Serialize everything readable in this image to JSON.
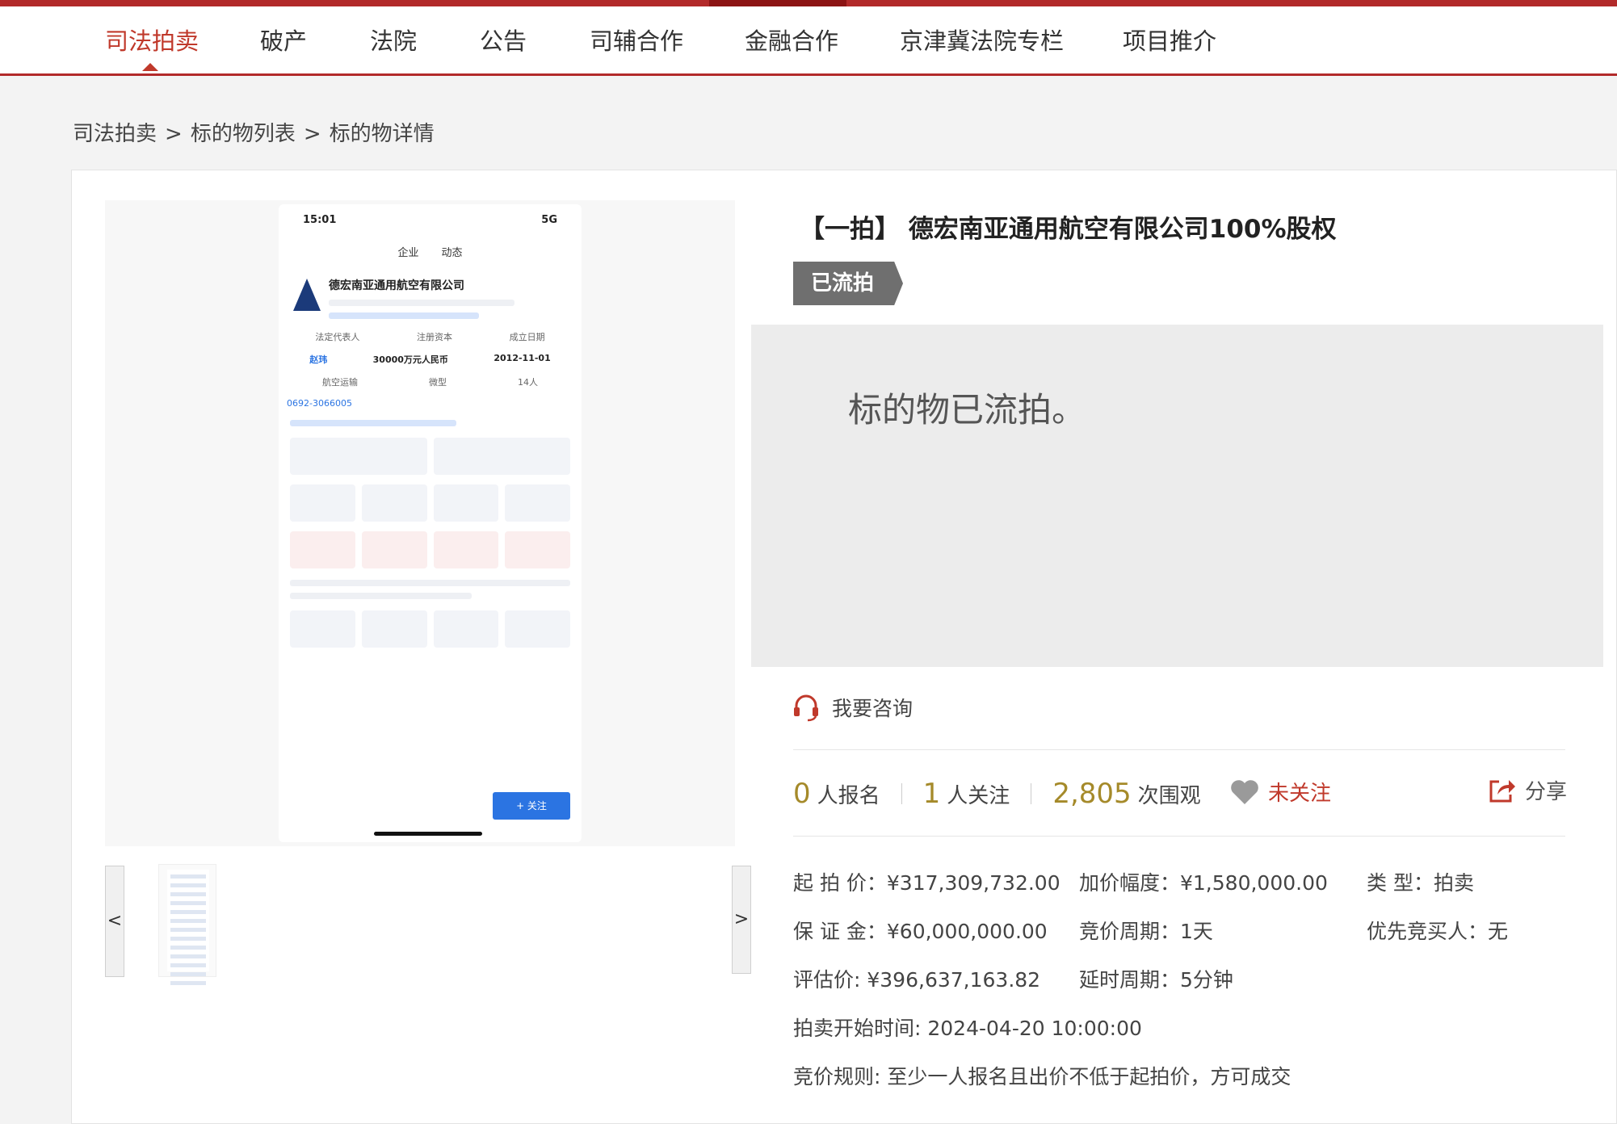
{
  "nav": {
    "items": [
      "司法拍卖",
      "破产",
      "法院",
      "公告",
      "司辅合作",
      "金融合作",
      "京津冀法院专栏",
      "项目推介"
    ],
    "active_index": 0
  },
  "breadcrumb": {
    "items": [
      "司法拍卖",
      "标的物列表",
      "标的物详情"
    ],
    "separator": ">"
  },
  "gallery": {
    "prev": "<",
    "next": ">",
    "phone": {
      "time": "15:01",
      "signal": "5G",
      "tab_company": "企业",
      "tab_dynamic": "动态",
      "company_name": "德宏南亚通用航空有限公司",
      "legal_rep_label": "法定代表人",
      "legal_rep": "赵玮",
      "capital_label": "注册资本",
      "capital": "30000万元人民币",
      "founded_label": "成立日期",
      "founded": "2012-11-01",
      "industry": "航空运输",
      "scale": "微型",
      "staff": "14人",
      "phone": "0692-3066005",
      "follow": "+ 关注"
    }
  },
  "item": {
    "title": "【一拍】 德宏南亚通用航空有限公司100%股权",
    "status": "已流拍",
    "notice": "标的物已流拍。"
  },
  "consult": {
    "label": "我要咨询"
  },
  "stats": {
    "signups": "0",
    "signups_unit": "人报名",
    "followers": "1",
    "followers_unit": "人关注",
    "views": "2,805",
    "views_unit": "次围观",
    "follow_label": "未关注",
    "share_label": "分享"
  },
  "details": {
    "start_price": "起 拍 价：¥317,309,732.00",
    "increment": "加价幅度：¥1,580,000.00",
    "type": "类 型：拍卖",
    "deposit": "保 证 金：¥60,000,000.00",
    "bid_period": "竞价周期：1天",
    "priority_buyer": "优先竞买人：无",
    "appraisal": "评估价:   ¥396,637,163.82",
    "delay_period": "延时周期：5分钟",
    "start_time": "拍卖开始时间:  2024-04-20 10:00:00",
    "bid_rule": "竞价规则:   至少一人报名且出价不低于起拍价，方可成交"
  },
  "colors": {
    "brand_red": "#b22a2a",
    "accent_gold": "#a58a2a",
    "status_gray": "#6f6f6f"
  }
}
